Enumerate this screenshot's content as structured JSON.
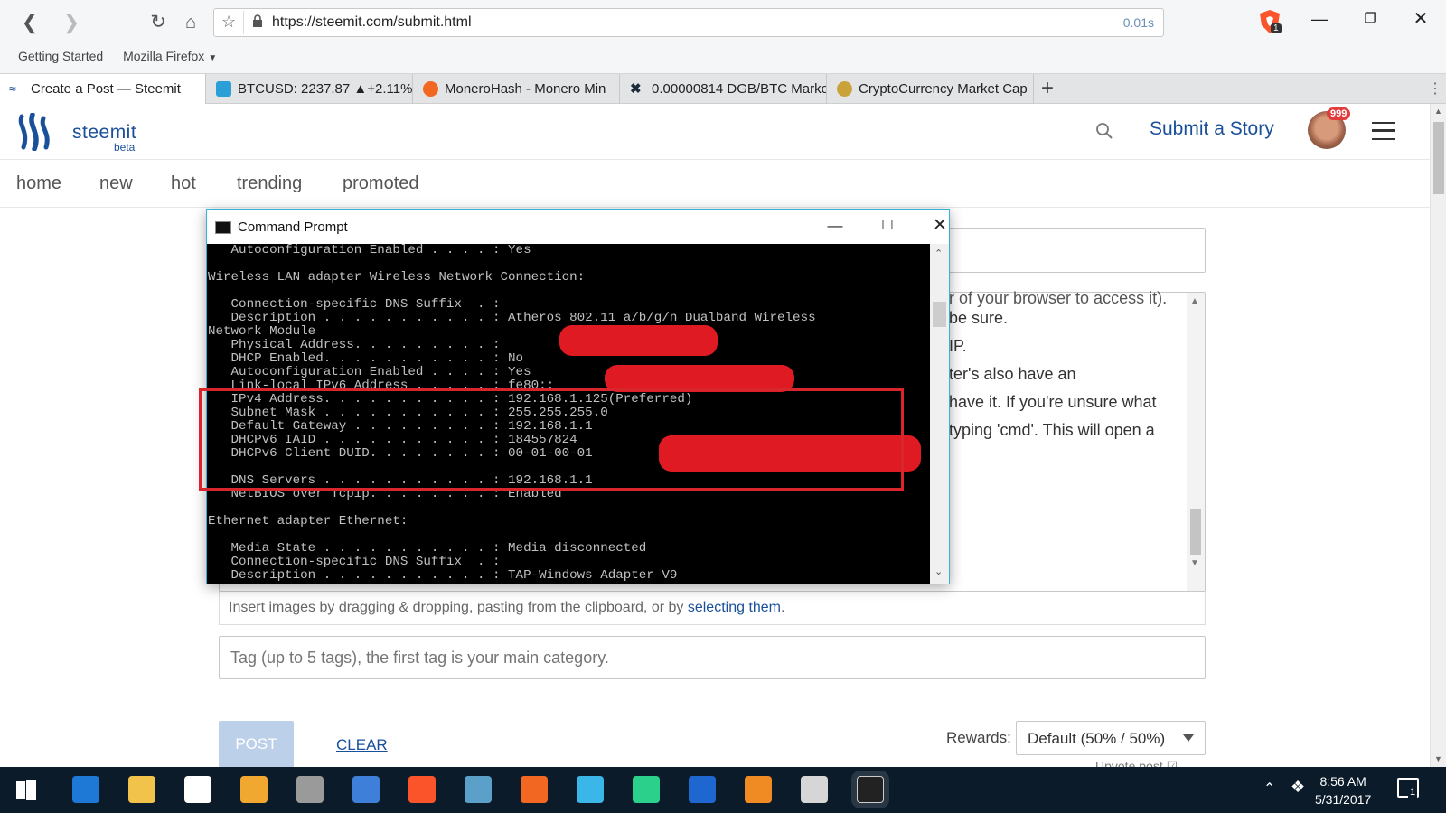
{
  "browser": {
    "url": "https://steemit.com/submit.html",
    "load_time": "0.01s",
    "bookmarks": [
      "Getting Started",
      "Mozilla Firefox"
    ],
    "tabs": [
      {
        "label": "Create a Post — Steemit",
        "color": "#1a5099"
      },
      {
        "label": "BTCUSD: 2237.87 ▲+2.11%",
        "color": "#2b9fd8"
      },
      {
        "label": "MoneroHash - Monero Min",
        "color": "#f26822"
      },
      {
        "label": "0.00000814 DGB/BTC Marke",
        "color": "#1c2b3a"
      },
      {
        "label": "CryptoCurrency Market Cap",
        "color": "#c9a23a"
      }
    ],
    "brave_badge": "1"
  },
  "steemit": {
    "logo": "steemit",
    "beta": "beta",
    "submit_label": "Submit a Story",
    "notification_count": "999",
    "nav": [
      "home",
      "new",
      "hot",
      "trending",
      "promoted"
    ]
  },
  "editor": {
    "visible_lines": [
      "r of your browser to access it).",
      "be sure.",
      "IP.",
      "ter's also have an",
      "have it. If you're unsure what",
      "typing 'cmd'. This will open a"
    ],
    "upload_hint": "Insert images by dragging & dropping, pasting from the clipboard, or by ",
    "upload_link": "selecting them",
    "upload_tail": ".",
    "tags_placeholder": "Tag (up to 5 tags), the first tag is your main category.",
    "post_label": "POST",
    "clear_label": "CLEAR",
    "rewards_label": "Rewards:",
    "rewards_value": "Default (50% / 50%)",
    "upvote_label": "Upvote post"
  },
  "cmd": {
    "title": "Command Prompt",
    "lines": [
      "   Autoconfiguration Enabled . . . . : Yes",
      "",
      "Wireless LAN adapter Wireless Network Connection:",
      "",
      "   Connection-specific DNS Suffix  . :",
      "   Description . . . . . . . . . . . : Atheros 802.11 a/b/g/n Dualband Wireless",
      "Network Module",
      "   Physical Address. . . . . . . . . :",
      "   DHCP Enabled. . . . . . . . . . . : No",
      "   Autoconfiguration Enabled . . . . : Yes",
      "   Link-local IPv6 Address . . . . . : fe80::                 9(Preferred)",
      "   IPv4 Address. . . . . . . . . . . : 192.168.1.125(Preferred)",
      "   Subnet Mask . . . . . . . . . . . : 255.255.255.0",
      "   Default Gateway . . . . . . . . . : 192.168.1.1",
      "   DHCPv6 IAID . . . . . . . . . . . : 184557824",
      "   DHCPv6 Client DUID. . . . . . . . : 00-01-00-01",
      "",
      "   DNS Servers . . . . . . . . . . . : 192.168.1.1",
      "   NetBIOS over Tcpip. . . . . . . . : Enabled",
      "",
      "Ethernet adapter Ethernet:",
      "",
      "   Media State . . . . . . . . . . . : Media disconnected",
      "   Connection-specific DNS Suffix  . :",
      "   Description . . . . . . . . . . . : TAP-Windows Adapter V9"
    ]
  },
  "taskbar": {
    "time": "8:56 AM",
    "date": "5/31/2017",
    "notifications": "1",
    "icons": [
      {
        "name": "edge-icon",
        "color": "#1e78d6"
      },
      {
        "name": "file-explorer-icon",
        "color": "#f2c34b"
      },
      {
        "name": "store-icon",
        "color": "#ffffff"
      },
      {
        "name": "media-player-icon",
        "color": "#f0a830"
      },
      {
        "name": "java-icon",
        "color": "#9a9a9a"
      },
      {
        "name": "app-icon",
        "color": "#3d7fd9"
      },
      {
        "name": "brave-icon",
        "color": "#fb542b"
      },
      {
        "name": "wallet-icon",
        "color": "#5aa0c8"
      },
      {
        "name": "monero-icon",
        "color": "#f26822"
      },
      {
        "name": "xcel-icon",
        "color": "#3ab7e8"
      },
      {
        "name": "sia-icon",
        "color": "#2bd18b"
      },
      {
        "name": "bittrex-icon",
        "color": "#1e66d0"
      },
      {
        "name": "jaxx-icon",
        "color": "#f08a23"
      },
      {
        "name": "paint-icon",
        "color": "#d6d6d6"
      },
      {
        "name": "cmd-icon",
        "color": "#222222"
      }
    ]
  }
}
